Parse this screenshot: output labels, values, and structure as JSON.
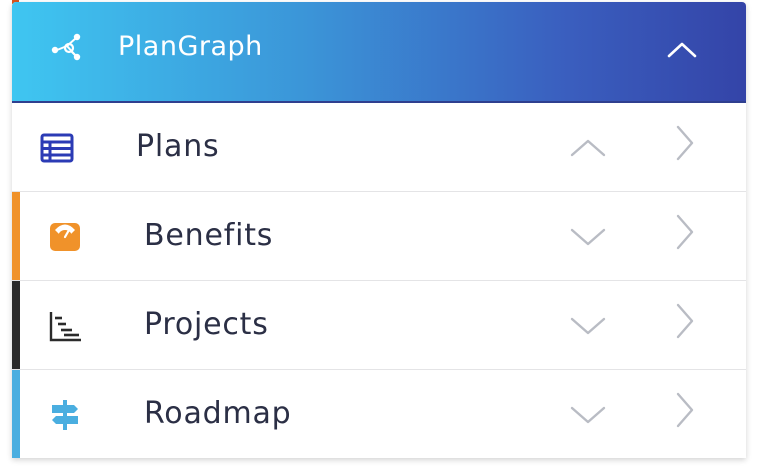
{
  "app": {
    "title": "PlanGraph",
    "header_icon": "network-graph-icon",
    "header_toggle_icon": "chevron-up-icon",
    "gradient": [
      "#3fc6f1",
      "#3444a8"
    ]
  },
  "menu": {
    "items": [
      {
        "label": "Plans",
        "icon": "table-icon",
        "accent": "",
        "toggle_icon": "chevron-up-icon",
        "arrow_icon": "chevron-right-icon",
        "icon_color": "#2b3bb5"
      },
      {
        "label": "Benefits",
        "icon": "scale-icon",
        "accent": "#f0922a",
        "toggle_icon": "chevron-down-icon",
        "arrow_icon": "chevron-right-icon",
        "icon_color": "#f0922a"
      },
      {
        "label": "Projects",
        "icon": "gantt-chart-icon",
        "accent": "#2b2b2b",
        "toggle_icon": "chevron-down-icon",
        "arrow_icon": "chevron-right-icon",
        "icon_color": "#2b2b2b"
      },
      {
        "label": "Roadmap",
        "icon": "signpost-icon",
        "accent": "#4aaee0",
        "toggle_icon": "chevron-down-icon",
        "arrow_icon": "chevron-right-icon",
        "icon_color": "#4aaee0"
      }
    ]
  }
}
